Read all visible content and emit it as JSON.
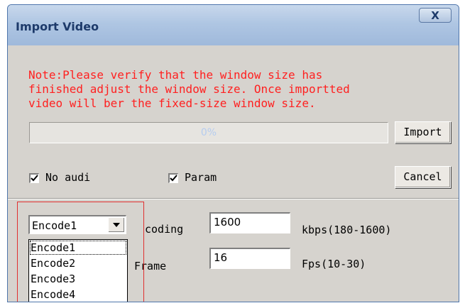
{
  "window": {
    "title": "Import Video",
    "close_label": "X"
  },
  "note": "Note:Please verify that the window size has\nfinished adjust the window size. Once importted\nvideo will ber the fixed-size window size.",
  "progress": {
    "value_percent": 0,
    "label": "0%"
  },
  "buttons": {
    "import": "Import",
    "cancel": "Cancel"
  },
  "options": {
    "no_audio": {
      "label": "No audi",
      "checked": true
    },
    "param": {
      "label": "Param",
      "checked": true
    }
  },
  "encoder": {
    "selected": "Encode1",
    "options": [
      "Encode1",
      "Encode2",
      "Encode3",
      "Encode4"
    ]
  },
  "coding": {
    "label": "coding",
    "value": "1600",
    "unit": "kbps(180-1600)"
  },
  "frame": {
    "label": "Frame",
    "value": "16",
    "unit": "Fps(10-30)"
  }
}
